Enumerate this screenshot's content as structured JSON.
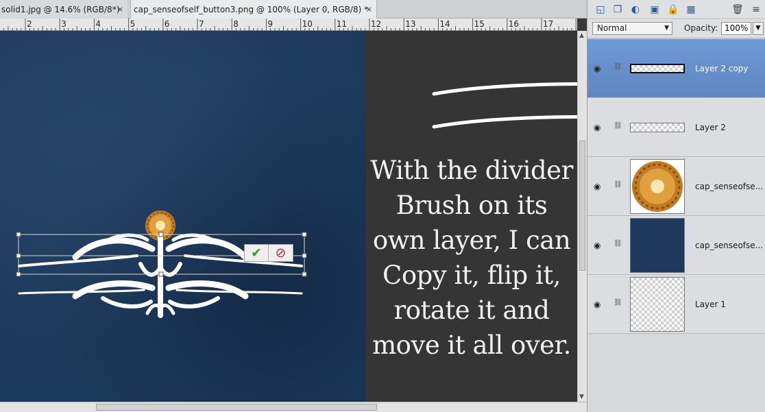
{
  "tabs": [
    {
      "label": "solid1.jpg @ 14.6% (RGB/8*)",
      "close": "×"
    },
    {
      "label": "cap_senseofself_button3.png @ 100% (Layer 0, RGB/8) *",
      "close": "×"
    }
  ],
  "ruler": {
    "numbers": [
      "2",
      "3",
      "4",
      "5",
      "6",
      "7",
      "8",
      "9",
      "10",
      "11",
      "12",
      "13",
      "14",
      "15",
      "16",
      "17"
    ]
  },
  "caption": "With the divider Brush on its own layer, I can Copy it, flip it, rotate it and move it all over.",
  "commit": {
    "ok_icon": "✔",
    "cancel_icon": "⊘"
  },
  "layers_panel": {
    "blend_mode": "Normal",
    "opacity_label": "Opacity:",
    "opacity_value": "100%",
    "layers": [
      {
        "name": "Layer 2 copy",
        "selected": true
      },
      {
        "name": "Layer 2",
        "selected": false
      },
      {
        "name": "cap_senseofse...",
        "selected": false
      },
      {
        "name": "cap_senseofse...",
        "selected": false
      },
      {
        "name": "Layer 1",
        "selected": false
      }
    ]
  },
  "colors": {
    "canvas_blue": "#1d3a5c",
    "selection_blue": "#6f9ad6",
    "caption_bg": "#353535",
    "gold": "#c8862a"
  }
}
